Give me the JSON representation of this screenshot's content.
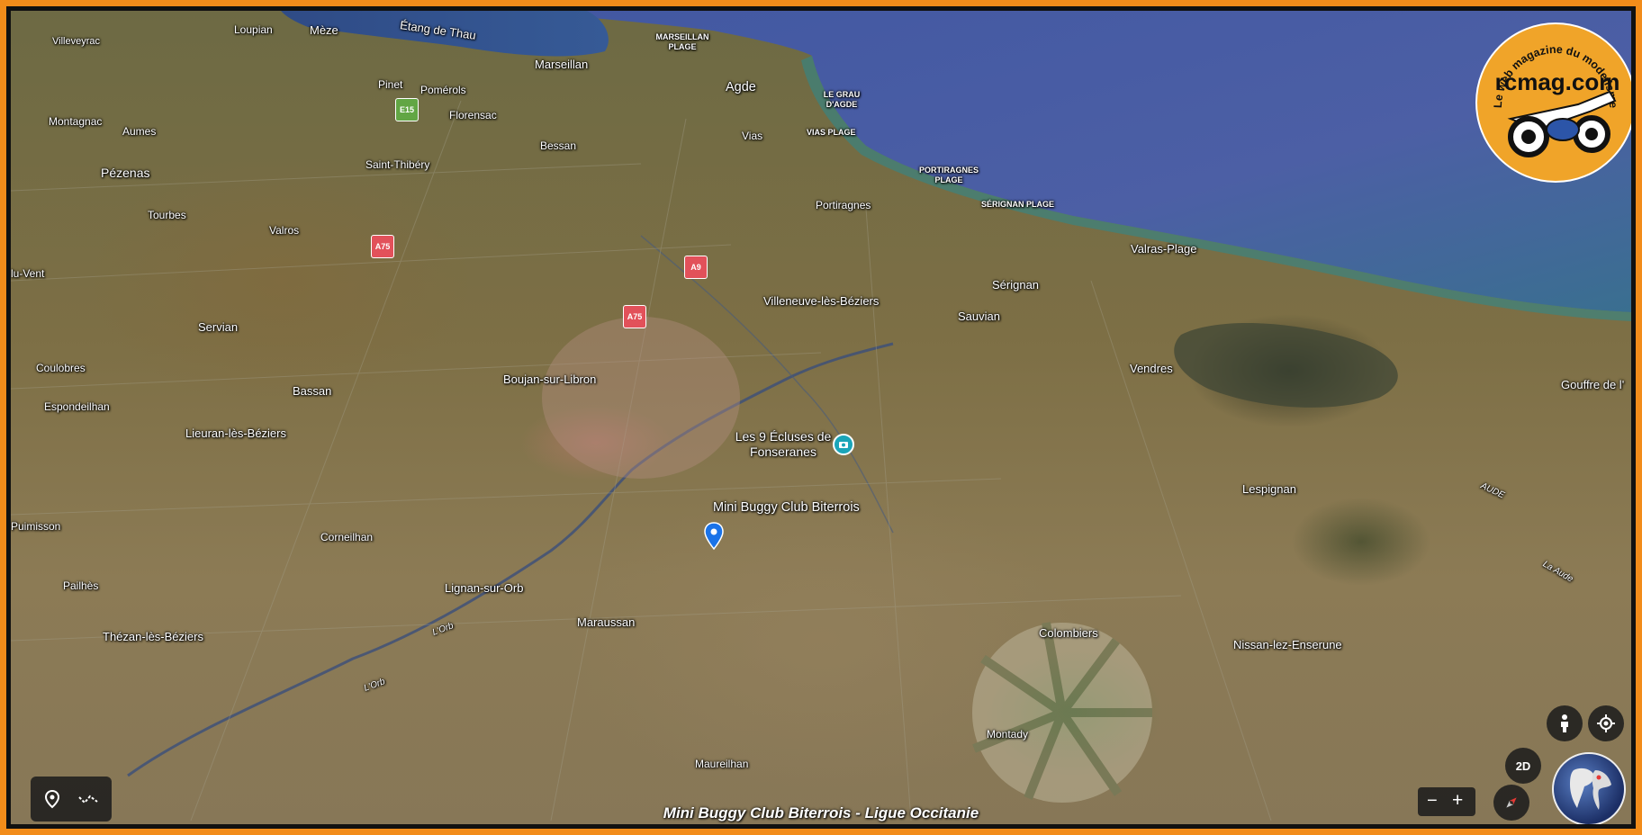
{
  "places": {
    "loupian": "Loupian",
    "meze": "Mèze",
    "etang_de_thau": "Étang de Thau",
    "marseillan_plage": "MARSEILLAN PLAGE",
    "villeveyrac": "Villeveyrac",
    "marseillan": "Marseillan",
    "agde": "Agde",
    "pinet": "Pinet",
    "pomerols": "Pomérols",
    "le_grau_dagde": "LE GRAU D'AGDE",
    "montagnac": "Montagnac",
    "florensac": "Florensac",
    "aumes": "Aumes",
    "vias": "Vias",
    "vias_plage": "VIAS PLAGE",
    "bessan": "Bessan",
    "pezenas": "Pézenas",
    "saint_thibery": "Saint-Thibéry",
    "portiragnes_plage": "PORTIRAGNES PLAGE",
    "portiragnes": "Portiragnes",
    "serignan_plage": "SÉRIGNAN PLAGE",
    "tourbes": "Tourbes",
    "valros": "Valros",
    "valras_plage": "Valras-Plage",
    "lu_vent": "lu-Vent",
    "serignan": "Sérignan",
    "villeneuve_les_beziers": "Villeneuve-lès-Béziers",
    "sauvian": "Sauvian",
    "servian": "Servian",
    "coulobres": "Coulobres",
    "vendres": "Vendres",
    "boujan_sur_libron": "Boujan-sur-Libron",
    "gouffre": "Gouffre de l'",
    "bassan": "Bassan",
    "espondeilhan": "Espondeilhan",
    "lieuran_les_beziers": "Lieuran-lès-Béziers",
    "lespignan": "Lespignan",
    "aude": "AUDE",
    "puimisson": "Puimisson",
    "corneilhan": "Corneilhan",
    "lauude": "La Aude",
    "pailhes": "Pailhès",
    "lignan_sur_orb": "Lignan-sur-Orb",
    "maraussan": "Maraussan",
    "colombiers": "Colombiers",
    "nissan_lez_enserune": "Nissan-lez-Enserune",
    "thezan_les_beziers": "Thézan-lès-Béziers",
    "lorb1": "L'Orb",
    "lorb2": "L'Orb",
    "montady": "Montady",
    "maureilhan": "Maureilhan"
  },
  "roads": {
    "e15": "E15",
    "a75_1": "A75",
    "a9": "A9",
    "a75_2": "A75"
  },
  "poi": {
    "name": "Les 9 Écluses de Fonseranes"
  },
  "marker": {
    "label": "Mini Buggy Club Biterrois"
  },
  "logo": {
    "site": "rcmag.com",
    "tagline": "Le web magazine du modelisme"
  },
  "controls": {
    "view_2d": "2D",
    "zoom_out": "−",
    "zoom_in": "+"
  },
  "footer": {
    "title": "Mini Buggy Club Biterrois - Ligue Occitanie"
  },
  "colors": {
    "frame": "#f28c1a",
    "sea": "#4c5fa5",
    "poi": "#1aa5b8",
    "marker": "#1a73e8",
    "red_shield": "#e2515a",
    "green_shield": "#62a644"
  }
}
